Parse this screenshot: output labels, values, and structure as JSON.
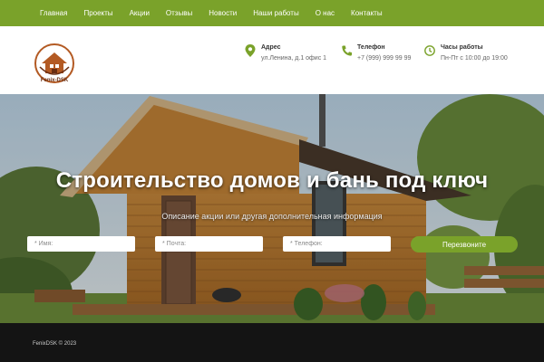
{
  "nav": {
    "items": [
      {
        "label": "Главная"
      },
      {
        "label": "Проекты"
      },
      {
        "label": "Акции"
      },
      {
        "label": "Отзывы"
      },
      {
        "label": "Новости"
      },
      {
        "label": "Наши работы"
      },
      {
        "label": "О нас"
      },
      {
        "label": "Контакты"
      }
    ]
  },
  "header": {
    "logo_text": "Fenix-DSK",
    "address": {
      "title": "Адрес",
      "value": "ул.Ленина, д.1 офис 1",
      "icon": "map-pin-icon"
    },
    "phone": {
      "title": "Телефон",
      "value": "+7 (999) 999 99 99",
      "icon": "phone-icon"
    },
    "hours": {
      "title": "Часы работы",
      "value": "Пн-Пт с 10:00 до 19:00",
      "icon": "clock-icon"
    }
  },
  "hero": {
    "title": "Строительство домов и бань под ключ",
    "subtitle": "Описание акции или другая дополнительная информация",
    "form": {
      "name_placeholder": "* Имя:",
      "email_placeholder": "* Почта:",
      "phone_placeholder": "* Телефон:",
      "submit_label": "Перезвоните"
    }
  },
  "footer": {
    "copyright": "FenixDSK © 2023"
  },
  "colors": {
    "accent": "#7aa22a",
    "footer": "#141414",
    "logo": "#b35a23"
  }
}
